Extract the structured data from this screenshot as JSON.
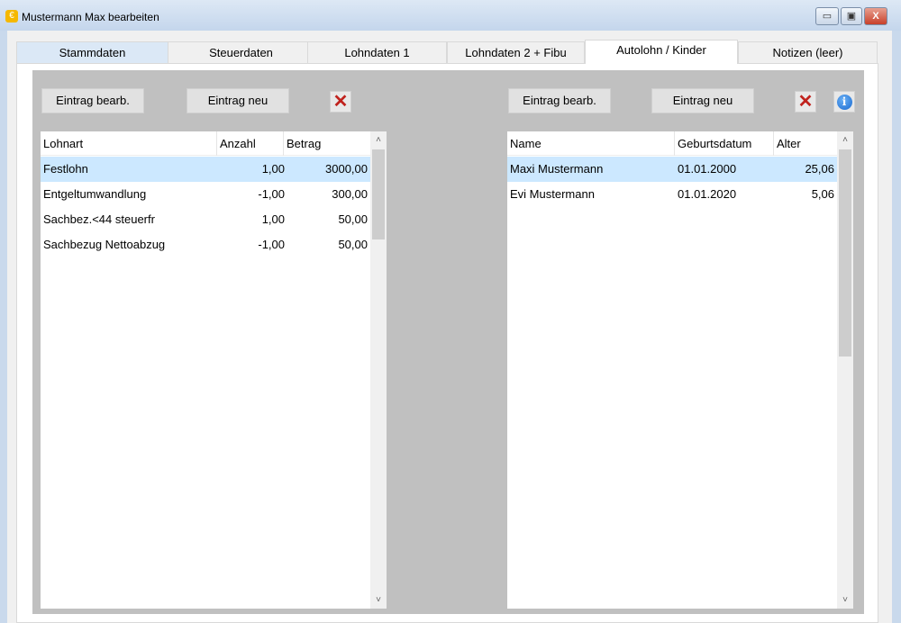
{
  "window": {
    "title": "Mustermann Max bearbeiten",
    "minimize": "▭",
    "maximize": "▣",
    "close": "X"
  },
  "tabs": [
    {
      "label": "Stammdaten"
    },
    {
      "label": "Steuerdaten"
    },
    {
      "label": "Lohndaten 1"
    },
    {
      "label": "Lohndaten 2 + Fibu"
    },
    {
      "label": "Autolohn / Kinder"
    },
    {
      "label": "Notizen (leer)"
    }
  ],
  "left": {
    "edit": "Eintrag bearb.",
    "new": "Eintrag neu",
    "delete": "✕",
    "columns": [
      "Lohnart",
      "Anzahl",
      "Betrag"
    ],
    "rows": [
      [
        "Festlohn",
        "1,00",
        "3000,00"
      ],
      [
        "Entgeltumwandlung",
        "-1,00",
        "300,00"
      ],
      [
        "Sachbez.<44 steuerfr",
        "1,00",
        "50,00"
      ],
      [
        "Sachbezug Nettoabzug",
        "-1,00",
        "50,00"
      ]
    ]
  },
  "right": {
    "edit": "Eintrag bearb.",
    "new": "Eintrag neu",
    "delete": "✕",
    "info": "i",
    "columns": [
      "Name",
      "Geburtsdatum",
      "Alter"
    ],
    "rows": [
      [
        "Maxi Mustermann",
        "01.01.2000",
        "25,06"
      ],
      [
        "Evi Mustermann",
        "01.01.2020",
        "5,06"
      ]
    ]
  },
  "scroll": {
    "up": "˄",
    "down": "˅"
  }
}
